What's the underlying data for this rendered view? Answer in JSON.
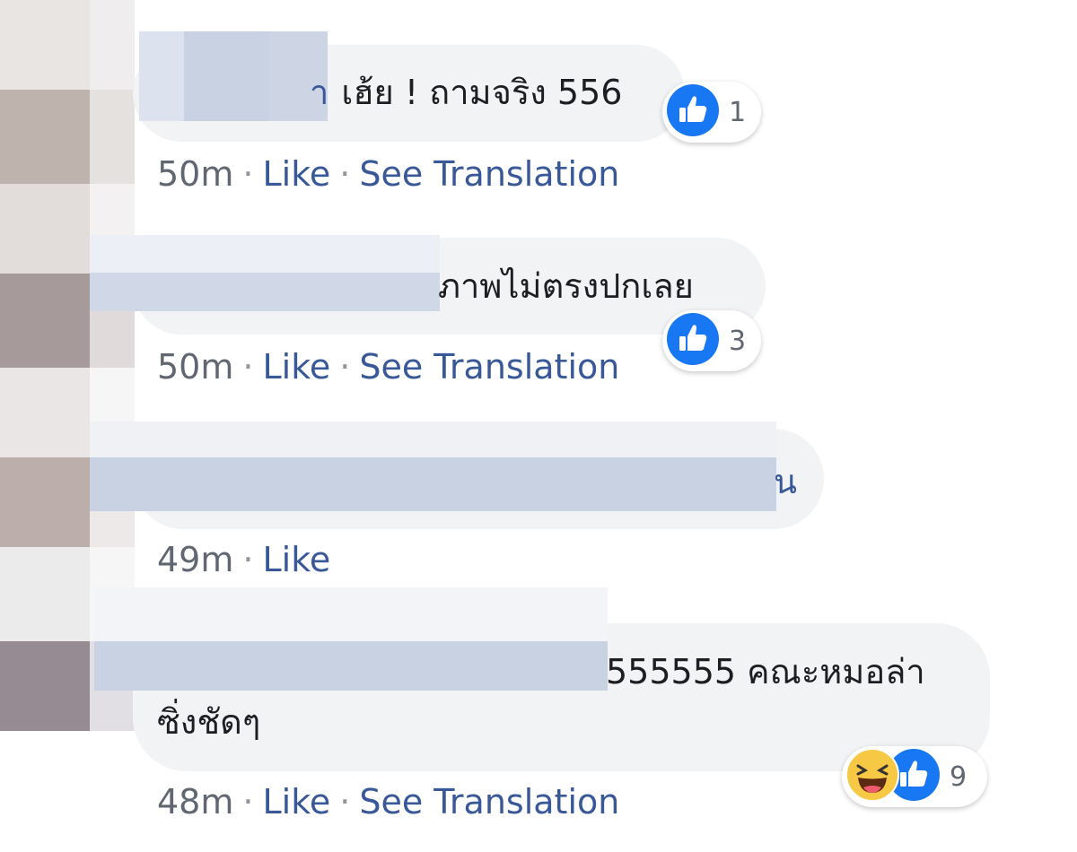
{
  "comments": [
    {
      "text": "เฮ้ย ! ถามจริง 556",
      "name_tail": "า",
      "time": "50m",
      "like": "Like",
      "translate": "See Translation",
      "reactions": {
        "icons": [
          "like-icon"
        ],
        "count": "1"
      }
    },
    {
      "text": "ภาพไม่ตรงปกเลย",
      "time": "50m",
      "like": "Like",
      "translate": "See Translation",
      "reactions": {
        "icons": [
          "like-icon"
        ],
        "count": "3"
      }
    },
    {
      "text": "น",
      "time": "49m",
      "like": "Like"
    },
    {
      "text_line1": "555555 คณะหมอล่า",
      "text_line2": "ซิ่งชัดๆ",
      "time": "48m",
      "like": "Like",
      "translate": "See Translation",
      "reactions": {
        "icons": [
          "haha-icon",
          "like-icon"
        ],
        "count": "9"
      }
    }
  ],
  "separator": "·",
  "colors": {
    "bubble": "#f2f3f5",
    "link": "#385898",
    "time": "#606770",
    "like_blue": "#1877f2",
    "haha_yellow": "#f7c843"
  }
}
